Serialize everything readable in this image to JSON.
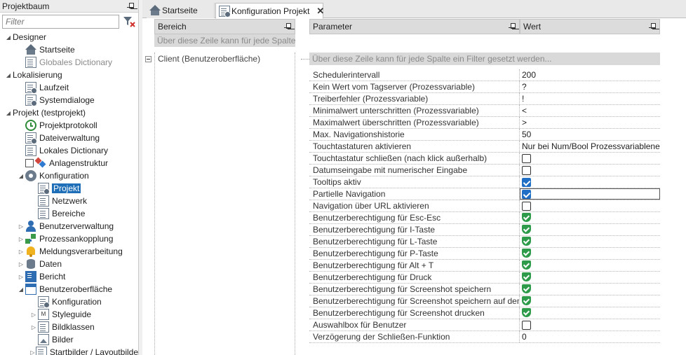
{
  "tree": {
    "title": "Projektbaum",
    "filter_placeholder": "Filter",
    "items": [
      {
        "label": "Designer",
        "level": 0,
        "exp": "open",
        "icon": ""
      },
      {
        "label": "Startseite",
        "level": 1,
        "icon": "home"
      },
      {
        "label": "Globales Dictionary",
        "level": 1,
        "icon": "doc",
        "dim": true
      },
      {
        "label": "Lokalisierung",
        "level": 0,
        "exp": "open",
        "icon": ""
      },
      {
        "label": "Laufzeit",
        "level": 1,
        "icon": "docgear"
      },
      {
        "label": "Systemdialoge",
        "level": 1,
        "icon": "docgear"
      },
      {
        "label": "Projekt (testprojekt)",
        "level": 0,
        "exp": "open",
        "icon": ""
      },
      {
        "label": "Projektprotokoll",
        "level": 1,
        "icon": "history"
      },
      {
        "label": "Dateiverwaltung",
        "level": 1,
        "icon": "docgear"
      },
      {
        "label": "Lokales Dictionary",
        "level": 1,
        "icon": "doc"
      },
      {
        "label": "Anlagenstruktur",
        "level": 1,
        "icon": "plant",
        "checkbox": true
      },
      {
        "label": "Konfiguration",
        "level": 1,
        "exp": "open",
        "icon": "gear"
      },
      {
        "label": "Projekt",
        "level": 2,
        "icon": "docgear",
        "selected": true
      },
      {
        "label": "Netzwerk",
        "level": 2,
        "icon": "doc"
      },
      {
        "label": "Bereiche",
        "level": 2,
        "icon": "doc"
      },
      {
        "label": "Benutzerverwaltung",
        "level": 1,
        "exp": "closed",
        "icon": "user"
      },
      {
        "label": "Prozessankopplung",
        "level": 1,
        "exp": "closed",
        "icon": "process"
      },
      {
        "label": "Meldungsverarbeitung",
        "level": 1,
        "exp": "closed",
        "icon": "bell"
      },
      {
        "label": "Daten",
        "level": 1,
        "exp": "closed",
        "icon": "db"
      },
      {
        "label": "Bericht",
        "level": 1,
        "exp": "closed",
        "icon": "report"
      },
      {
        "label": "Benutzeroberfläche",
        "level": 1,
        "exp": "open",
        "icon": "ui"
      },
      {
        "label": "Konfiguration",
        "level": 2,
        "icon": "docgear"
      },
      {
        "label": "Styleguide",
        "level": 2,
        "exp": "closed",
        "icon": "style"
      },
      {
        "label": "Bildklassen",
        "level": 2,
        "exp": "closed",
        "icon": "doc"
      },
      {
        "label": "Bilder",
        "level": 2,
        "icon": "images"
      },
      {
        "label": "Startbilder / Layoutbilde",
        "level": 2,
        "exp": "closed",
        "icon": "doc"
      }
    ]
  },
  "tabs": [
    {
      "label": "Startseite"
    },
    {
      "label": "Konfiguration Projekt"
    }
  ],
  "bereich": {
    "header": "Bereich",
    "filter_text": "Über diese Zeile kann für jede Spalte...",
    "client": "Client (Benutzeroberfläche)"
  },
  "params": {
    "header_param": "Parameter",
    "header_value": "Wert",
    "filter_text": "Über diese Zeile kann für jede Spalte ein Filter gesetzt werden...",
    "rows": [
      {
        "name": "Schedulerintervall",
        "type": "text",
        "value": "200"
      },
      {
        "name": "Kein Wert vom Tagserver (Prozessvariable)",
        "type": "text",
        "value": "?"
      },
      {
        "name": "Treiberfehler (Prozessvariable)",
        "type": "text",
        "value": "!"
      },
      {
        "name": "Minimalwert unterschritten (Prozessvariable)",
        "type": "text",
        "value": "<"
      },
      {
        "name": "Maximalwert überschritten (Prozessvariable)",
        "type": "text",
        "value": ">"
      },
      {
        "name": "Max. Navigationshistorie",
        "type": "text",
        "value": "50"
      },
      {
        "name": "Touchtastaturen aktivieren",
        "type": "text",
        "value": "Nur bei Num/Bool Prozessvariablenei..."
      },
      {
        "name": "Touchtastatur schließen (nach klick außerhalb)",
        "type": "check",
        "value": false
      },
      {
        "name": "Datumseingabe mit numerischer Eingabe",
        "type": "check",
        "value": false
      },
      {
        "name": "Tooltips aktiv",
        "type": "check",
        "value": true
      },
      {
        "name": "Partielle Navigation",
        "type": "check",
        "value": true,
        "focused": true
      },
      {
        "name": "Navigation über URL aktivieren",
        "type": "check",
        "value": false
      },
      {
        "name": "Benutzerberechtigung für Esc-Esc",
        "type": "shield"
      },
      {
        "name": "Benutzerberechtigung für I-Taste",
        "type": "shield"
      },
      {
        "name": "Benutzerberechtigung für L-Taste",
        "type": "shield"
      },
      {
        "name": "Benutzerberechtigung für P-Taste",
        "type": "shield"
      },
      {
        "name": "Benutzerberechtigung für Alt + T",
        "type": "shield"
      },
      {
        "name": "Benutzerberechtigung für Druck",
        "type": "shield"
      },
      {
        "name": "Benutzerberechtigung für Screenshot speichern",
        "type": "shield"
      },
      {
        "name": "Benutzerberechtigung für Screenshot speichern auf dem...",
        "type": "shield"
      },
      {
        "name": "Benutzerberechtigung für Screenshot drucken",
        "type": "shield"
      },
      {
        "name": "Auswahlbox für Benutzer",
        "type": "check",
        "value": false
      },
      {
        "name": "Verzögerung der Schließen-Funktion",
        "type": "text",
        "value": "0"
      }
    ]
  },
  "colors": {
    "selection": "#1f6fb8",
    "checkbox_on": "#1f6fc6",
    "shield": "#2e9b4a"
  }
}
